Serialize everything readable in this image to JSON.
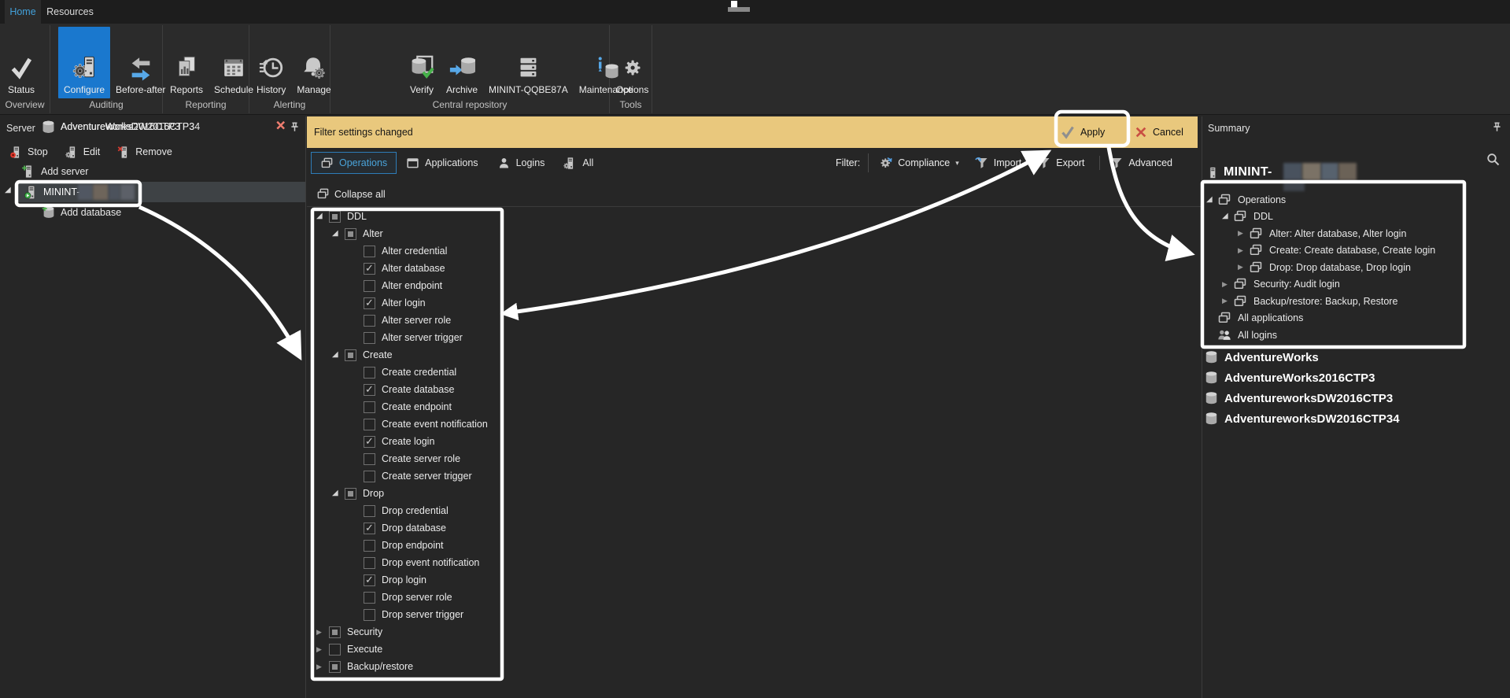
{
  "colors": {
    "accent_blue": "#1a78ce",
    "tab_blue": "#42a0da",
    "banner_yellow": "#e9c87d",
    "alert_red": "#ec7c6f",
    "annotation_white": "#ffffff"
  },
  "window_tabs": [
    {
      "label": "Home",
      "active": true
    },
    {
      "label": "Resources",
      "active": false
    }
  ],
  "ribbon": {
    "groups": [
      {
        "label": "Overview",
        "buttons": [
          {
            "label": "Status",
            "icon": "status"
          }
        ]
      },
      {
        "label": "Auditing",
        "buttons": [
          {
            "label": "Configure",
            "icon": "configure",
            "active": true
          },
          {
            "label": "Before-after",
            "icon": "before-after"
          }
        ]
      },
      {
        "label": "Reporting",
        "buttons": [
          {
            "label": "Reports",
            "icon": "reports"
          },
          {
            "label": "Schedule",
            "icon": "schedule"
          }
        ]
      },
      {
        "label": "Alerting",
        "buttons": [
          {
            "label": "History",
            "icon": "history"
          },
          {
            "label": "Manage",
            "icon": "manage"
          }
        ]
      },
      {
        "label": "Central repository",
        "buttons": [
          {
            "label": "Verify",
            "icon": "verify"
          },
          {
            "label": "Archive",
            "icon": "archive"
          },
          {
            "label": "MININT-QQBE87A",
            "icon": "repository"
          },
          {
            "label": "Maintenance",
            "icon": "maintenance"
          }
        ]
      },
      {
        "label": "Tools",
        "buttons": [
          {
            "label": "Options",
            "icon": "options"
          }
        ]
      }
    ]
  },
  "server_panel": {
    "title": "Server",
    "toolbar": [
      {
        "label": "Stop",
        "icon": "stop-server"
      },
      {
        "label": "Edit",
        "icon": "server-gear"
      },
      {
        "label": "Remove",
        "icon": "remove-server"
      }
    ],
    "add_server": "Add server",
    "server_name": "MININT-",
    "add_database": "Add database",
    "remove_glyph": "✕",
    "databases": [
      {
        "name": "AdventureWorks"
      },
      {
        "name": "AdventureWorks2016CTP3"
      },
      {
        "name": "AdventureworksDW2016CTP3"
      },
      {
        "name": "AdventureworksDW2016CTP34"
      }
    ]
  },
  "banner": {
    "message": "Filter settings changed",
    "apply": "Apply",
    "cancel": "Cancel"
  },
  "filter_tabs": [
    {
      "label": "Operations",
      "icon": "layers",
      "active": true
    },
    {
      "label": "Applications",
      "icon": "window",
      "active": false
    },
    {
      "label": "Logins",
      "icon": "person",
      "active": false
    },
    {
      "label": "All",
      "icon": "server-gear-sm",
      "active": false
    }
  ],
  "filter_bar": {
    "label": "Filter:",
    "buttons": [
      {
        "label": "Compliance",
        "icon": "gearsync",
        "caret": true
      },
      {
        "label": "Import",
        "icon": "funnel-import"
      },
      {
        "label": "Export",
        "icon": "funnel-export"
      },
      {
        "label": "Advanced",
        "icon": "funnel",
        "sep_before": true
      }
    ]
  },
  "operations_panel": {
    "collapse_all": "Collapse all",
    "tree": [
      {
        "label": "DDL",
        "level": "0",
        "state": "indeterminate",
        "expand": "expanded"
      },
      {
        "label": "Alter",
        "level": "1",
        "state": "indeterminate",
        "expand": "expanded"
      },
      {
        "label": "Alter credential",
        "level": "2",
        "state": "unchecked"
      },
      {
        "label": "Alter database",
        "level": "2",
        "state": "checked"
      },
      {
        "label": "Alter endpoint",
        "level": "2",
        "state": "unchecked"
      },
      {
        "label": "Alter login",
        "level": "2",
        "state": "checked"
      },
      {
        "label": "Alter server role",
        "level": "2",
        "state": "unchecked"
      },
      {
        "label": "Alter server trigger",
        "level": "2",
        "state": "unchecked"
      },
      {
        "label": "Create",
        "level": "1",
        "state": "indeterminate",
        "expand": "expanded"
      },
      {
        "label": "Create credential",
        "level": "2",
        "state": "unchecked"
      },
      {
        "label": "Create database",
        "level": "2",
        "state": "checked"
      },
      {
        "label": "Create endpoint",
        "level": "2",
        "state": "unchecked"
      },
      {
        "label": "Create event notification",
        "level": "2",
        "state": "unchecked"
      },
      {
        "label": "Create login",
        "level": "2",
        "state": "checked"
      },
      {
        "label": "Create server role",
        "level": "2",
        "state": "unchecked"
      },
      {
        "label": "Create server trigger",
        "level": "2",
        "state": "unchecked"
      },
      {
        "label": "Drop",
        "level": "1",
        "state": "indeterminate",
        "expand": "expanded"
      },
      {
        "label": "Drop credential",
        "level": "2",
        "state": "unchecked"
      },
      {
        "label": "Drop database",
        "level": "2",
        "state": "checked"
      },
      {
        "label": "Drop endpoint",
        "level": "2",
        "state": "unchecked"
      },
      {
        "label": "Drop event notification",
        "level": "2",
        "state": "unchecked"
      },
      {
        "label": "Drop login",
        "level": "2",
        "state": "checked"
      },
      {
        "label": "Drop server role",
        "level": "2",
        "state": "unchecked"
      },
      {
        "label": "Drop server trigger",
        "level": "2",
        "state": "unchecked"
      },
      {
        "label": "Security",
        "level": "0",
        "state": "indeterminate",
        "expand": "collapsed"
      },
      {
        "label": "Execute",
        "level": "0",
        "state": "unchecked",
        "expand": "collapsed"
      },
      {
        "label": "Backup/restore",
        "level": "0",
        "state": "indeterminate",
        "expand": "collapsed"
      }
    ]
  },
  "summary_panel": {
    "title": "Summary",
    "server_name": "MININT-",
    "items": [
      {
        "label": "Operations",
        "level": "0",
        "icon": "layers",
        "expand": "expanded"
      },
      {
        "label": "DDL",
        "level": "1",
        "icon": "layers",
        "expand": "expanded"
      },
      {
        "label": "Alter: Alter database, Alter login",
        "level": "2",
        "icon": "layers",
        "expand": "collapsed"
      },
      {
        "label": "Create: Create database, Create login",
        "level": "2",
        "icon": "layers",
        "expand": "collapsed"
      },
      {
        "label": "Drop: Drop database, Drop login",
        "level": "2",
        "icon": "layers",
        "expand": "collapsed"
      },
      {
        "label": "Security: Audit login",
        "level": "1",
        "icon": "layers",
        "expand": "collapsed"
      },
      {
        "label": "Backup/restore: Backup, Restore",
        "level": "1",
        "icon": "layers",
        "expand": "collapsed"
      },
      {
        "label": "All applications",
        "level": "0",
        "icon": "layers"
      },
      {
        "label": "All logins",
        "level": "0",
        "icon": "people"
      }
    ],
    "databases": [
      {
        "name": "AdventureWorks"
      },
      {
        "name": "AdventureWorks2016CTP3"
      },
      {
        "name": "AdventureworksDW2016CTP3"
      },
      {
        "name": "AdventureworksDW2016CTP34"
      }
    ]
  }
}
